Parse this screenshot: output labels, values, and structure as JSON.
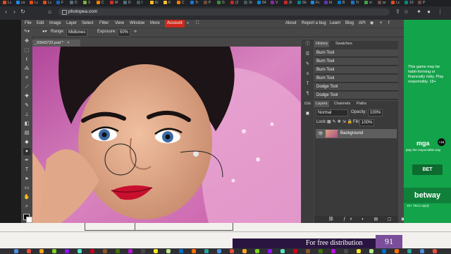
{
  "browser": {
    "tabs": [
      {
        "label": "Lc",
        "color": "#e64a19"
      },
      {
        "label": "ca",
        "color": "#1e88e5"
      },
      {
        "label": "Lc",
        "color": "#e64a19"
      },
      {
        "label": "Lc",
        "color": "#e64a19"
      },
      {
        "label": "F",
        "color": "#1565c0"
      },
      {
        "label": "D",
        "color": "#546e7a"
      },
      {
        "label": "S",
        "color": "#7cb342"
      },
      {
        "label": "C",
        "color": "#f57c00"
      },
      {
        "label": "M",
        "color": "#d32f2f"
      },
      {
        "label": "D",
        "color": "#546e7a"
      },
      {
        "label": "I",
        "color": "#455a64"
      },
      {
        "label": "Ki",
        "color": "#fbc02d"
      },
      {
        "label": "K",
        "color": "#fbc02d"
      },
      {
        "label": "C",
        "color": "#f57c00"
      },
      {
        "label": "Tr",
        "color": "#1976d2"
      },
      {
        "label": "P",
        "color": "#6d4c41"
      },
      {
        "label": "G",
        "color": "#388e3c"
      },
      {
        "label": "(2",
        "color": "#c62828"
      },
      {
        "label": "St",
        "color": "#455a64"
      },
      {
        "label": "54",
        "color": "#0288d1"
      },
      {
        "label": "V",
        "color": "#8e24aa"
      },
      {
        "label": "(6",
        "color": "#c62828"
      },
      {
        "label": "Sk",
        "color": "#00838f"
      },
      {
        "label": "Fc",
        "color": "#1e88e5"
      },
      {
        "label": "bl",
        "color": "#5e35b1"
      },
      {
        "label": "B",
        "color": "#0277bd"
      },
      {
        "label": "Tr",
        "color": "#1976d2"
      },
      {
        "label": "vi",
        "color": "#43a047"
      },
      {
        "label": "ar",
        "color": "#6d4c41"
      },
      {
        "label": "Lc",
        "color": "#e64a19"
      },
      {
        "label": "10",
        "color": "#00897b"
      },
      {
        "label": "P",
        "color": "#6d4c41"
      }
    ],
    "url": "photopea.com"
  },
  "menu": {
    "items": [
      "File",
      "Edit",
      "Image",
      "Layer",
      "Select",
      "Filter",
      "View",
      "Window",
      "More"
    ],
    "account": "Account",
    "right_items": [
      "About",
      "Report a bug",
      "Learn",
      "Blog",
      "API"
    ]
  },
  "options": {
    "range_label": "Range:",
    "range_value": "Midtones",
    "exposure_label": "Exposure:",
    "exposure_value": "50%"
  },
  "document": {
    "tab_title": "_SSH3722.psd *",
    "close": "×"
  },
  "history": {
    "tabs": [
      "History",
      "Swatches"
    ],
    "items": [
      "Burn Tool",
      "Burn Tool",
      "Burn Tool",
      "Burn Tool",
      "Dodge Tool",
      "Dodge Tool"
    ]
  },
  "layers": {
    "tabs": [
      "Layers",
      "Channels",
      "Paths"
    ],
    "blend_mode": "Normal",
    "opacity_label": "Opacity:",
    "opacity_value": "100%",
    "lock_label": "Lock:",
    "fill_label": "Fill:",
    "fill_value": "100%",
    "layer_name": "Background"
  },
  "ad": {
    "disclaimer": "This game may be habit-forming or financially risky. Play responsibly. 18+",
    "mga": "mga",
    "responsible": "play the responsible way",
    "age": "+18",
    "bet_button": "BET",
    "brand": "betway",
    "terms": "18+ T&Cs apply"
  },
  "footer": {
    "text": "For free distribution",
    "page_number": "91"
  },
  "colors": {
    "account": "#cc2a1d",
    "ad_green": "#13a34a",
    "footer_band": "#2a1540",
    "page_badge": "#7a4e9a"
  }
}
